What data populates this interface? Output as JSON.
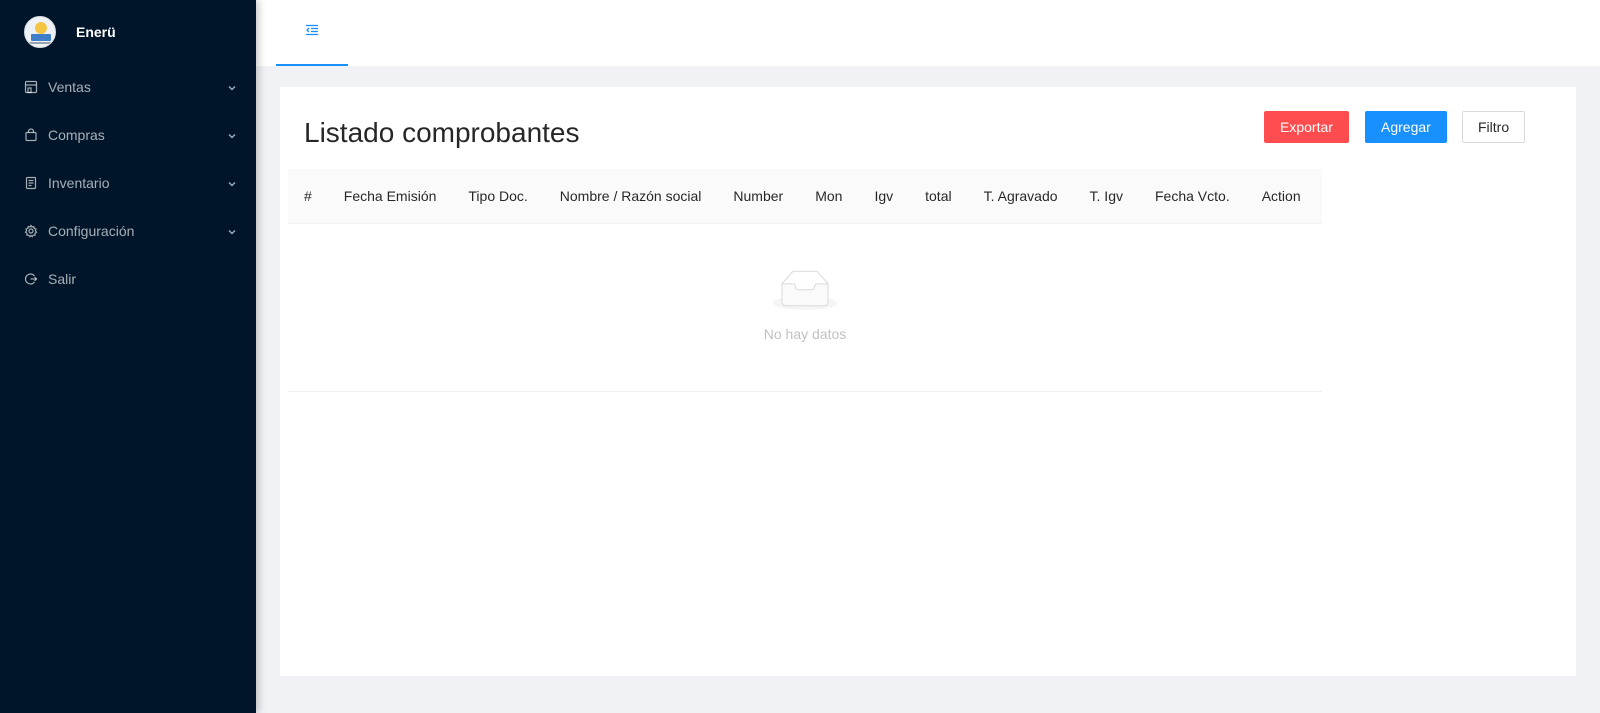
{
  "app": {
    "brand": "Enerü"
  },
  "sidebar": {
    "items": [
      {
        "label": "Ventas",
        "icon": "shop-icon",
        "has_submenu": true
      },
      {
        "label": "Compras",
        "icon": "shopping-bag-icon",
        "has_submenu": true
      },
      {
        "label": "Inventario",
        "icon": "document-list-icon",
        "has_submenu": true
      },
      {
        "label": "Configuración",
        "icon": "gear-icon",
        "has_submenu": true
      },
      {
        "label": "Salir",
        "icon": "logout-icon",
        "has_submenu": false
      }
    ]
  },
  "header": {
    "active_tab_icon": "menu-fold-icon"
  },
  "main": {
    "title": "Listado comprobantes",
    "buttons": {
      "export": "Exportar",
      "add": "Agregar",
      "filter": "Filtro"
    },
    "table": {
      "columns": [
        "#",
        "Fecha Emisión",
        "Tipo Doc.",
        "Nombre / Razón social",
        "Number",
        "Mon",
        "Igv",
        "total",
        "T. Agravado",
        "T. Igv",
        "Fecha Vcto.",
        "Action"
      ],
      "rows": [],
      "empty_text": "No hay datos"
    }
  },
  "colors": {
    "sidebar_bg": "#001529",
    "primary": "#1890ff",
    "danger": "#ff4d4f",
    "page_bg": "#f0f2f5"
  }
}
